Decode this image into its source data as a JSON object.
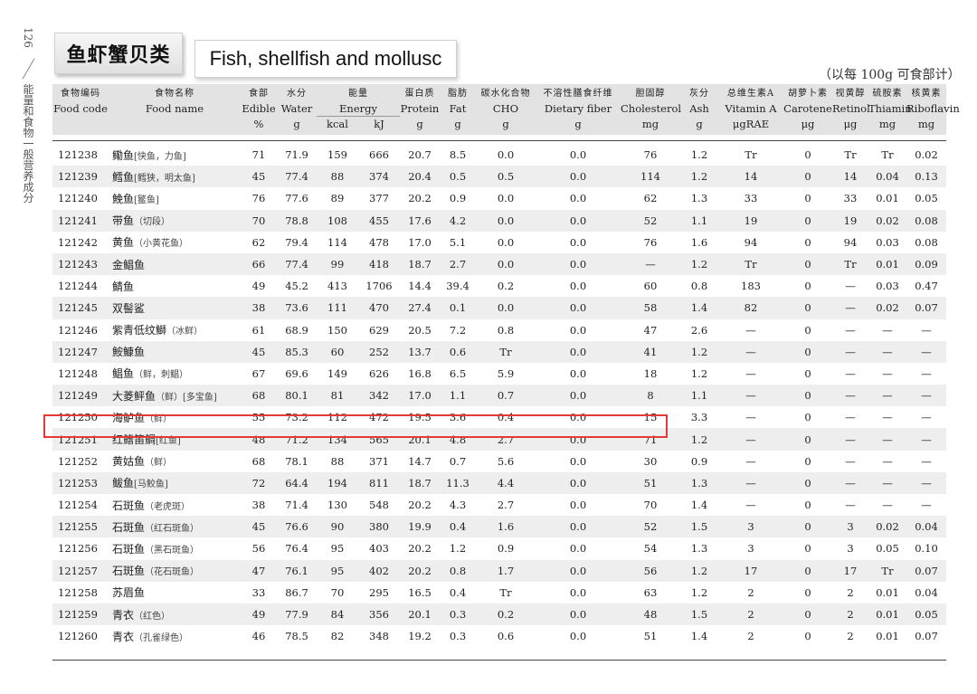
{
  "sidebar": {
    "page_number": "126",
    "running_title": "能量和食物一般营养成分"
  },
  "section": {
    "title_cn": "鱼虾蟹贝类",
    "title_en": "Fish, shellfish and mollusc"
  },
  "unit_note": "（以每 100g 可食部计）",
  "highlight_color": "#e53935",
  "table": {
    "header_cn": [
      "食物编码",
      "食物名称",
      "食部",
      "水分",
      "能量",
      "蛋白质",
      "脂肪",
      "碳水化合物",
      "不溶性膳食纤维",
      "胆固醇",
      "灰分",
      "总维生素A",
      "胡萝卜素",
      "视黄醇",
      "硫胺素",
      "核黄素"
    ],
    "header_en": [
      "Food code",
      "Food name",
      "Edible",
      "Water",
      "Energy",
      "Protein",
      "Fat",
      "CHO",
      "Dietary fiber",
      "Cholesterol",
      "Ash",
      "Vitamin A",
      "Carotene",
      "Retinol",
      "Thiamin",
      "Riboflavin"
    ],
    "header_units": [
      "",
      "",
      "%",
      "g",
      "kcal",
      "kJ",
      "g",
      "g",
      "g",
      "g",
      "mg",
      "g",
      "μgRAE",
      "μg",
      "μg",
      "mg",
      "mg"
    ],
    "rows": [
      {
        "code": "121238",
        "name": "鳓鱼",
        "alias": "[快鱼，力鱼]",
        "vals": [
          "71",
          "71.9",
          "159",
          "666",
          "20.7",
          "8.5",
          "0.0",
          "0.0",
          "76",
          "1.2",
          "Tr",
          "0",
          "Tr",
          "Tr",
          "0.02"
        ]
      },
      {
        "code": "121239",
        "name": "鳕鱼",
        "alias": "[鳕狭，明太鱼]",
        "vals": [
          "45",
          "77.4",
          "88",
          "374",
          "20.4",
          "0.5",
          "0.5",
          "0.0",
          "114",
          "1.2",
          "14",
          "0",
          "14",
          "0.04",
          "0.13"
        ]
      },
      {
        "code": "121240",
        "name": "鮸鱼",
        "alias": "[鳘鱼]",
        "vals": [
          "76",
          "77.6",
          "89",
          "377",
          "20.2",
          "0.9",
          "0.0",
          "0.0",
          "62",
          "1.3",
          "33",
          "0",
          "33",
          "0.01",
          "0.05"
        ]
      },
      {
        "code": "121241",
        "name": "带鱼",
        "alias": "（切段）",
        "vals": [
          "70",
          "78.8",
          "108",
          "455",
          "17.6",
          "4.2",
          "0.0",
          "0.0",
          "52",
          "1.1",
          "19",
          "0",
          "19",
          "0.02",
          "0.08"
        ]
      },
      {
        "code": "121242",
        "name": "黄鱼",
        "alias": "（小黄花鱼）",
        "vals": [
          "62",
          "79.4",
          "114",
          "478",
          "17.0",
          "5.1",
          "0.0",
          "0.0",
          "76",
          "1.6",
          "94",
          "0",
          "94",
          "0.03",
          "0.08"
        ]
      },
      {
        "code": "121243",
        "name": "金鲳鱼",
        "alias": "",
        "vals": [
          "66",
          "77.4",
          "99",
          "418",
          "18.7",
          "2.7",
          "0.0",
          "0.0",
          "—",
          "1.2",
          "Tr",
          "0",
          "Tr",
          "0.01",
          "0.09"
        ]
      },
      {
        "code": "121244",
        "name": "鲭鱼",
        "alias": "",
        "vals": [
          "49",
          "45.2",
          "413",
          "1706",
          "14.4",
          "39.4",
          "0.2",
          "0.0",
          "60",
          "0.8",
          "183",
          "0",
          "—",
          "0.03",
          "0.47"
        ]
      },
      {
        "code": "121245",
        "name": "双髻鲨",
        "alias": "",
        "vals": [
          "38",
          "73.6",
          "111",
          "470",
          "27.4",
          "0.1",
          "0.0",
          "0.0",
          "58",
          "1.4",
          "82",
          "0",
          "—",
          "0.02",
          "0.07"
        ]
      },
      {
        "code": "121246",
        "name": "紫青低纹鰤",
        "alias": "（冰鲜）",
        "vals": [
          "61",
          "68.9",
          "150",
          "629",
          "20.5",
          "7.2",
          "0.8",
          "0.0",
          "47",
          "2.6",
          "—",
          "0",
          "—",
          "—",
          "—"
        ]
      },
      {
        "code": "121247",
        "name": "鮟鱇鱼",
        "alias": "",
        "vals": [
          "45",
          "85.3",
          "60",
          "252",
          "13.7",
          "0.6",
          "Tr",
          "0.0",
          "41",
          "1.2",
          "—",
          "0",
          "—",
          "—",
          "—"
        ]
      },
      {
        "code": "121248",
        "name": "鲳鱼",
        "alias": "（鲜，刺鲳）",
        "vals": [
          "67",
          "69.6",
          "149",
          "626",
          "16.8",
          "6.5",
          "5.9",
          "0.0",
          "18",
          "1.2",
          "—",
          "0",
          "—",
          "—",
          "—"
        ]
      },
      {
        "code": "121249",
        "name": "大菱鲆鱼",
        "alias": "（鲜）[多宝鱼]",
        "vals": [
          "68",
          "80.1",
          "81",
          "342",
          "17.0",
          "1.1",
          "0.7",
          "0.0",
          "8",
          "1.1",
          "—",
          "0",
          "—",
          "—",
          "—"
        ]
      },
      {
        "code": "121250",
        "name": "海鲈鱼",
        "alias": "（鲜）",
        "vals": [
          "55",
          "73.2",
          "112",
          "472",
          "19.5",
          "3.6",
          "0.4",
          "0.0",
          "15",
          "3.3",
          "—",
          "0",
          "—",
          "—",
          "—"
        ]
      },
      {
        "code": "121251",
        "name": "红鳍笛鲷",
        "alias": "[红鱼]",
        "vals": [
          "48",
          "71.2",
          "134",
          "565",
          "20.1",
          "4.8",
          "2.7",
          "0.0",
          "71",
          "1.2",
          "—",
          "0",
          "—",
          "—",
          "—"
        ]
      },
      {
        "code": "121252",
        "name": "黄姑鱼",
        "alias": "（鲜）",
        "vals": [
          "68",
          "78.1",
          "88",
          "371",
          "14.7",
          "0.7",
          "5.6",
          "0.0",
          "30",
          "0.9",
          "—",
          "0",
          "—",
          "—",
          "—"
        ]
      },
      {
        "code": "121253",
        "name": "鲅鱼",
        "alias": "[马鲛鱼]",
        "vals": [
          "72",
          "64.4",
          "194",
          "811",
          "18.7",
          "11.3",
          "4.4",
          "0.0",
          "51",
          "1.3",
          "—",
          "0",
          "—",
          "—",
          "—"
        ]
      },
      {
        "code": "121254",
        "name": "石斑鱼",
        "alias": "（老虎斑）",
        "vals": [
          "38",
          "71.4",
          "130",
          "548",
          "20.2",
          "4.3",
          "2.7",
          "0.0",
          "70",
          "1.4",
          "—",
          "0",
          "—",
          "—",
          "—"
        ]
      },
      {
        "code": "121255",
        "name": "石斑鱼",
        "alias": "（红石斑鱼）",
        "vals": [
          "45",
          "76.6",
          "90",
          "380",
          "19.9",
          "0.4",
          "1.6",
          "0.0",
          "52",
          "1.5",
          "3",
          "0",
          "3",
          "0.02",
          "0.04"
        ]
      },
      {
        "code": "121256",
        "name": "石斑鱼",
        "alias": "（黑石斑鱼）",
        "vals": [
          "56",
          "76.4",
          "95",
          "403",
          "20.2",
          "1.2",
          "0.9",
          "0.0",
          "54",
          "1.3",
          "3",
          "0",
          "3",
          "0.05",
          "0.10"
        ]
      },
      {
        "code": "121257",
        "name": "石斑鱼",
        "alias": "（花石斑鱼）",
        "vals": [
          "47",
          "76.1",
          "95",
          "402",
          "20.2",
          "0.8",
          "1.7",
          "0.0",
          "56",
          "1.2",
          "17",
          "0",
          "17",
          "Tr",
          "0.07"
        ]
      },
      {
        "code": "121258",
        "name": "苏眉鱼",
        "alias": "",
        "vals": [
          "33",
          "86.7",
          "70",
          "295",
          "16.5",
          "0.4",
          "Tr",
          "0.0",
          "63",
          "1.2",
          "2",
          "0",
          "2",
          "0.01",
          "0.04"
        ]
      },
      {
        "code": "121259",
        "name": "青衣",
        "alias": "（红色）",
        "vals": [
          "49",
          "77.9",
          "84",
          "356",
          "20.1",
          "0.3",
          "0.2",
          "0.0",
          "48",
          "1.5",
          "2",
          "0",
          "2",
          "0.01",
          "0.05"
        ]
      },
      {
        "code": "121260",
        "name": "青衣",
        "alias": "（孔雀绿色）",
        "vals": [
          "46",
          "78.5",
          "82",
          "348",
          "19.2",
          "0.3",
          "0.6",
          "0.0",
          "51",
          "1.4",
          "2",
          "0",
          "2",
          "0.01",
          "0.07"
        ]
      }
    ]
  }
}
